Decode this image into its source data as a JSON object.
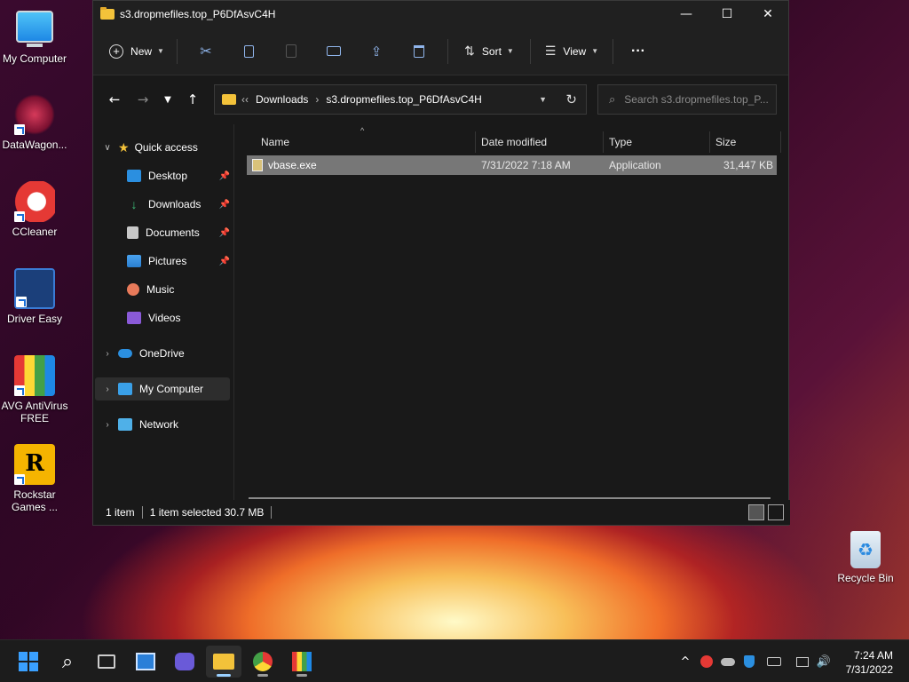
{
  "desktop": {
    "icons": [
      {
        "label": "My Computer"
      },
      {
        "label": "DataWagon..."
      },
      {
        "label": "CCleaner"
      },
      {
        "label": "Driver Easy"
      },
      {
        "label": "AVG AntiVirus FREE"
      },
      {
        "label": "Rockstar Games ..."
      },
      {
        "label": "Recycle Bin"
      }
    ]
  },
  "window": {
    "title": "s3.dropmefiles.top_P6DfAsvC4H",
    "controls": {
      "minimize": "—",
      "maximize": "☐",
      "close": "✕"
    },
    "toolbar": {
      "new_label": "New",
      "sort_label": "Sort",
      "view_label": "View",
      "more_label": "···"
    },
    "address": {
      "overflow": "‹‹",
      "crumbs": [
        "Downloads",
        "s3.dropmefiles.top_P6DfAsvC4H"
      ],
      "search_placeholder": "Search s3.dropmefiles.top_P..."
    },
    "nav": {
      "quick_access": "Quick access",
      "items": [
        {
          "label": "Desktop"
        },
        {
          "label": "Downloads"
        },
        {
          "label": "Documents"
        },
        {
          "label": "Pictures"
        },
        {
          "label": "Music"
        },
        {
          "label": "Videos"
        }
      ],
      "onedrive": "OneDrive",
      "my_computer": "My Computer",
      "network": "Network"
    },
    "columns": {
      "name": "Name",
      "date": "Date modified",
      "type": "Type",
      "size": "Size"
    },
    "files": [
      {
        "name": "vbase.exe",
        "date": "7/31/2022 7:18 AM",
        "type": "Application",
        "size": "31,447 KB"
      }
    ],
    "status": {
      "count": "1 item",
      "selected": "1 item selected  30.7 MB"
    }
  },
  "taskbar": {
    "clock_time": "7:24 AM",
    "clock_date": "7/31/2022"
  }
}
